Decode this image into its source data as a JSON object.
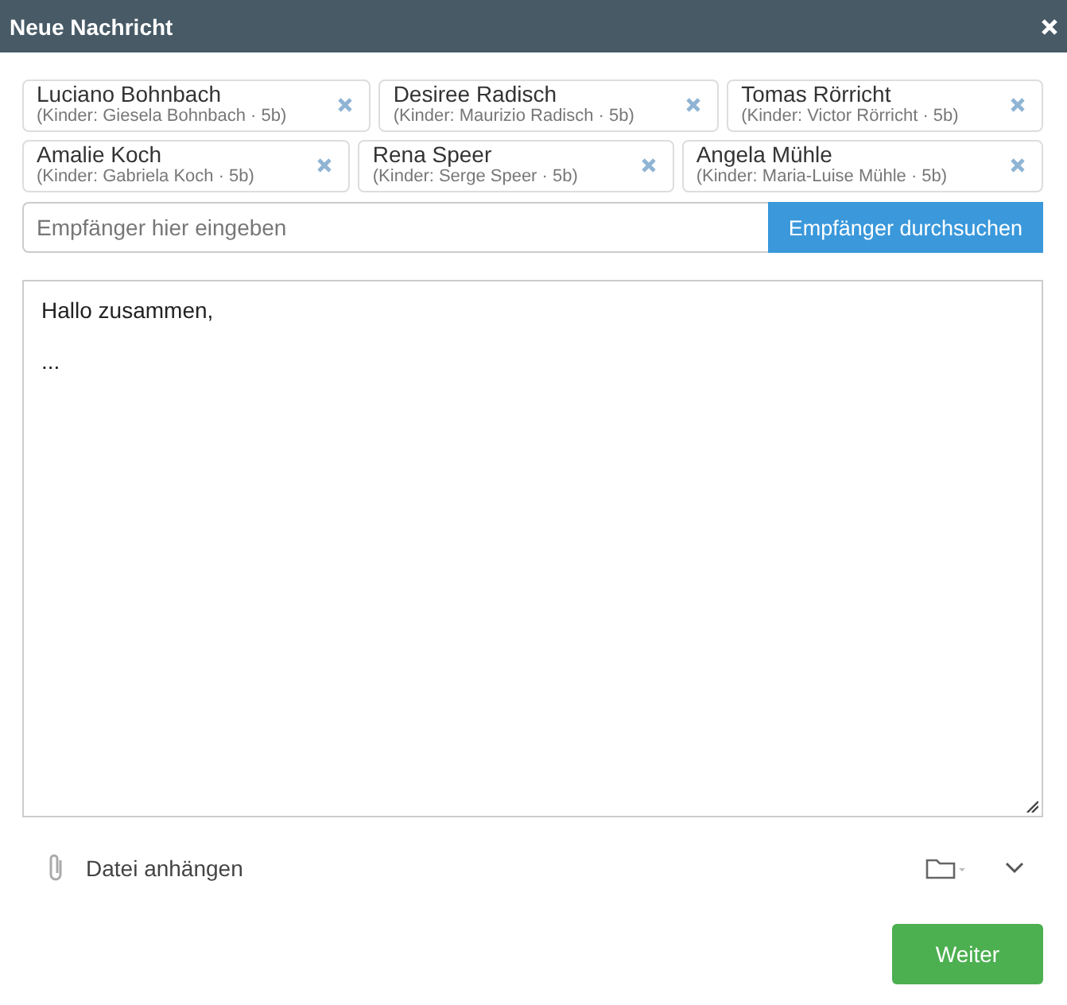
{
  "window": {
    "title": "Neue Nachricht"
  },
  "recipients": [
    {
      "name": "Luciano Bohnbach",
      "detail": "(Kinder: Giesela Bohnbach · 5b)"
    },
    {
      "name": "Desiree Radisch",
      "detail": "(Kinder: Maurizio Radisch · 5b)"
    },
    {
      "name": "Tomas Rörricht",
      "detail": "(Kinder: Victor Rörricht · 5b)"
    },
    {
      "name": "Amalie Koch",
      "detail": "(Kinder: Gabriela Koch · 5b)"
    },
    {
      "name": "Rena Speer",
      "detail": "(Kinder: Serge Speer · 5b)"
    },
    {
      "name": "Angela Mühle",
      "detail": "(Kinder: Maria-Luise Mühle · 5b)"
    }
  ],
  "recipient_input": {
    "placeholder": "Empfänger hier eingeben"
  },
  "search_button": "Empfänger durchsuchen",
  "message": "Hallo zusammen,\n\n...",
  "attach_label": "Datei anhängen",
  "next_button": "Weiter"
}
